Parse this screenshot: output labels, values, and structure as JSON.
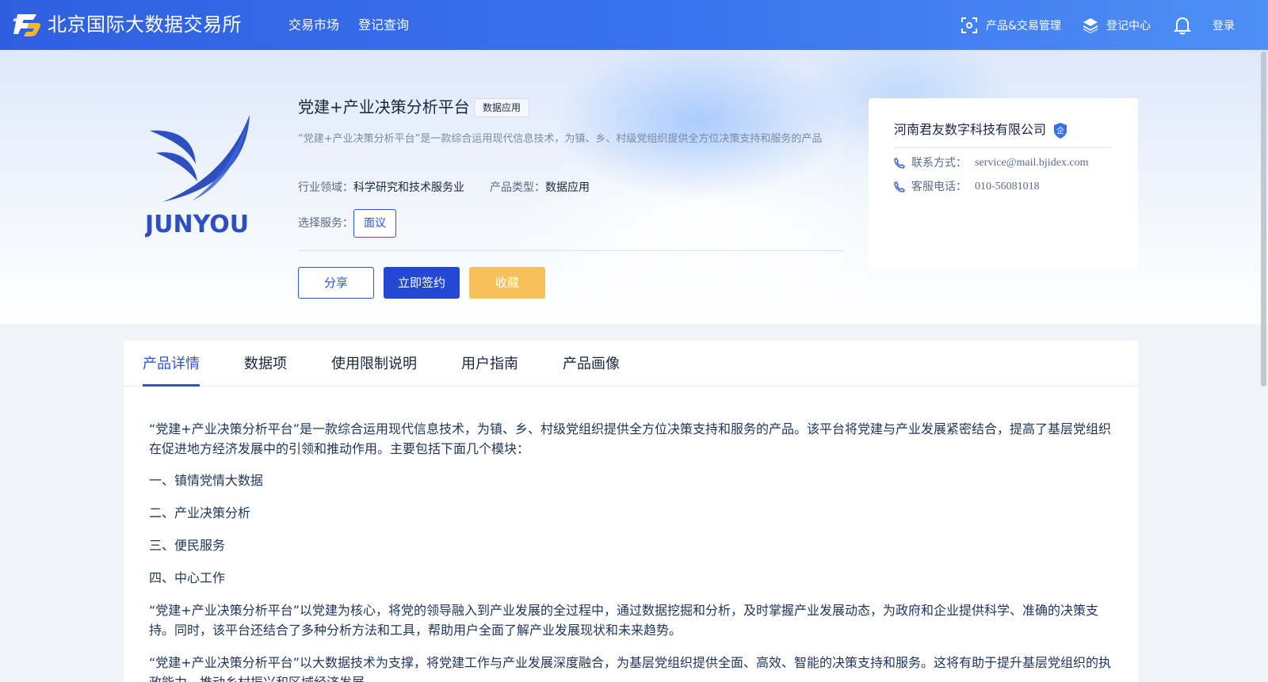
{
  "header": {
    "brand": "北京国际大数据交易所",
    "nav": [
      "交易市场",
      "登记查询"
    ],
    "product_manage": "产品&交易管理",
    "register_center": "登记中心",
    "login": "登录"
  },
  "product": {
    "logo_text": "JUNYOU",
    "title": "党建+产业决策分析平台",
    "tag": "数据应用",
    "description": "“党建+产业决策分析平台”是一款综合运用现代信息技术，为镇、乡、村级党组织提供全方位决策支持和服务的产品",
    "industry_label": "行业领域：",
    "industry_value": "科学研究和技术服务业",
    "type_label": "产品类型：",
    "type_value": "数据应用",
    "service_label": "选择服务：",
    "service_option": "面议",
    "share_label": "分享",
    "sign_label": "立即签约",
    "favorite_label": "收藏"
  },
  "company": {
    "name": "河南君友数字科技有限公司",
    "badge": "企",
    "contact_label": "联系方式：",
    "contact_value": "service@mail.bjidex.com",
    "phone_label": "客服电话：",
    "phone_value": "010-56081018"
  },
  "tabs": [
    {
      "label": "产品详情",
      "active": true
    },
    {
      "label": "数据项",
      "active": false
    },
    {
      "label": "使用限制说明",
      "active": false
    },
    {
      "label": "用户指南",
      "active": false
    },
    {
      "label": "产品画像",
      "active": false
    }
  ],
  "detail": [
    "“党建+产业决策分析平台”是一款综合运用现代信息技术，为镇、乡、村级党组织提供全方位决策支持和服务的产品。该平台将党建与产业发展紧密结合，提高了基层党组织在促进地方经济发展中的引领和推动作用。主要包括下面几个模块：",
    "一、镇情党情大数据",
    "二、产业决策分析",
    "三、便民服务",
    "四、中心工作",
    "“党建+产业决策分析平台”以党建为核心，将党的领导融入到产业发展的全过程中，通过数据挖掘和分析，及时掌握产业发展动态，为政府和企业提供科学、准确的决策支持。同时，该平台还结合了多种分析方法和工具，帮助用户全面了解产业发展现状和未来趋势。",
    "“党建+产业决策分析平台”以大数据技术为支撑，将党建工作与产业发展深度融合，为基层党组织提供全面、高效、智能的决策支持和服务。这将有助于提升基层党组织的执政能力，推动乡村振兴和区域经济发展。"
  ],
  "colors": {
    "header_gradient_start": "#2f5fe0",
    "header_gradient_end": "#4f8ef5",
    "primary": "#2248d4",
    "favorite": "#f6c15a",
    "logo_blue": "#2e4fc0"
  }
}
